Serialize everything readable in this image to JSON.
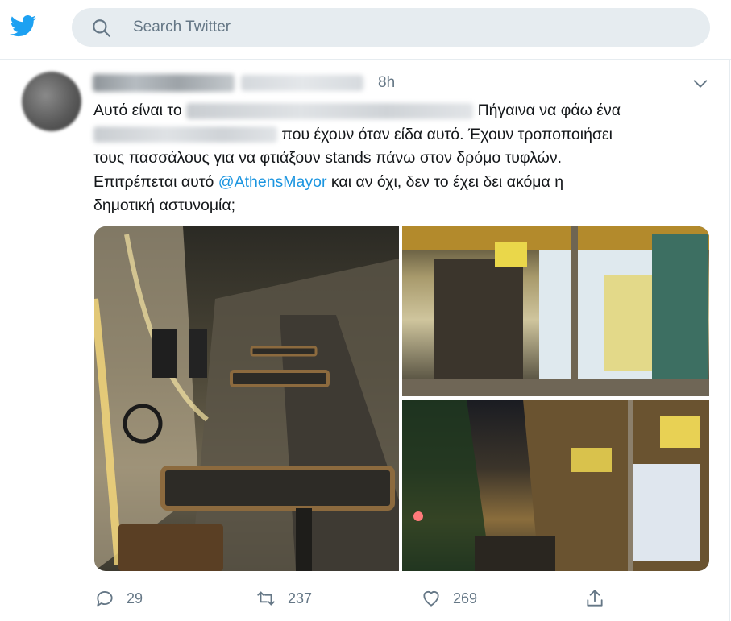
{
  "search": {
    "placeholder": "Search Twitter"
  },
  "tweet": {
    "time": "8h",
    "text_lines": [
      {
        "before": "Αυτό είναι το",
        "after": "Πήγαινα να φάω ένα"
      },
      {
        "before": "",
        "after": "που έχουν όταν είδα αυτό. Έχουν τροποποιήσει"
      },
      {
        "before": "τους πασσάλους για να φτιάξουν stands πάνω στον δρόμο τυφλών.",
        "after": ""
      },
      {
        "before": "Επιτρέπεται αυτό",
        "mention": "@AthensMayor",
        "after": "και αν όχι, δεν το έχει δει ακόμα η"
      },
      {
        "before": "δημοτική αστυνομία;",
        "after": ""
      }
    ],
    "stats": {
      "replies": "29",
      "retweets": "237",
      "likes": "269"
    }
  },
  "colors": {
    "brand": "#1da1f2",
    "link": "#1b95e0",
    "muted": "#657786"
  },
  "icons": {
    "logo": "twitter-bird-icon",
    "search": "search-icon",
    "caret": "chevron-down-icon",
    "reply": "reply-icon",
    "retweet": "retweet-icon",
    "like": "heart-icon",
    "share": "share-icon"
  }
}
